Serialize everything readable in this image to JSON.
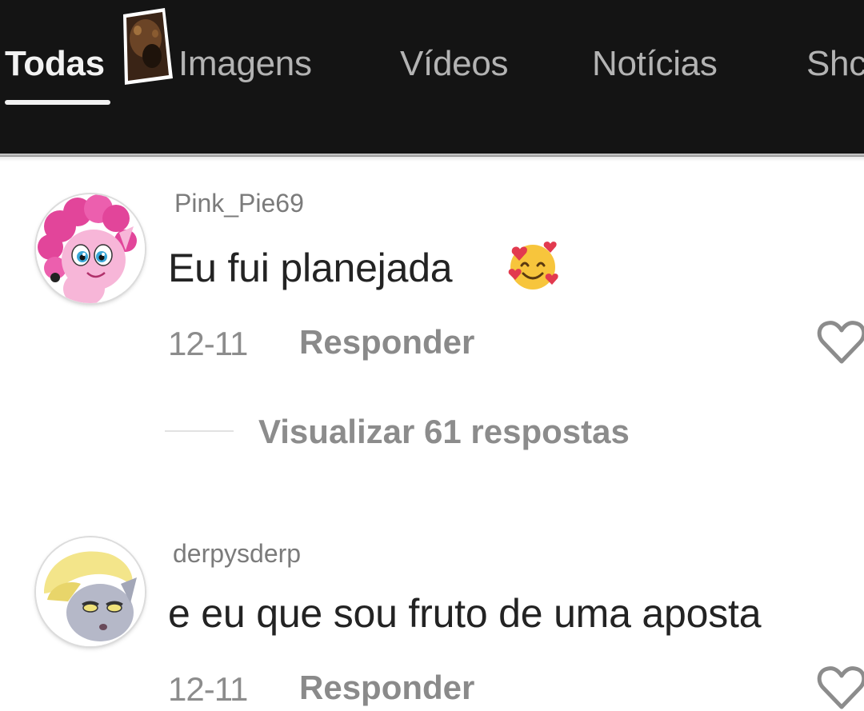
{
  "tabs": [
    {
      "label": "Todas",
      "active": true
    },
    {
      "label": "Imagens",
      "active": false
    },
    {
      "label": "Vídeos",
      "active": false
    },
    {
      "label": "Notícias",
      "active": false
    },
    {
      "label": "Shc",
      "active": false
    }
  ],
  "comments": [
    {
      "username": "Pink_Pie69",
      "text": "Eu fui planejada",
      "emoji": "smiling-face-with-hearts-icon",
      "date": "12-11",
      "reply_label": "Responder",
      "view_replies": "Visualizar 61 respostas",
      "avatar": "pink-pony-avatar"
    },
    {
      "username": "derpysderp",
      "text": "e eu que sou fruto de uma aposta",
      "date": "12-11",
      "reply_label": "Responder",
      "avatar": "grey-pony-avatar"
    }
  ],
  "colors": {
    "tabbar_bg": "#141414",
    "tab_active": "#f2f2f2",
    "tab_inactive": "#b3b3b3",
    "username": "#7b7b7b",
    "comment_text": "#232323",
    "meta": "#8c8c8c"
  }
}
